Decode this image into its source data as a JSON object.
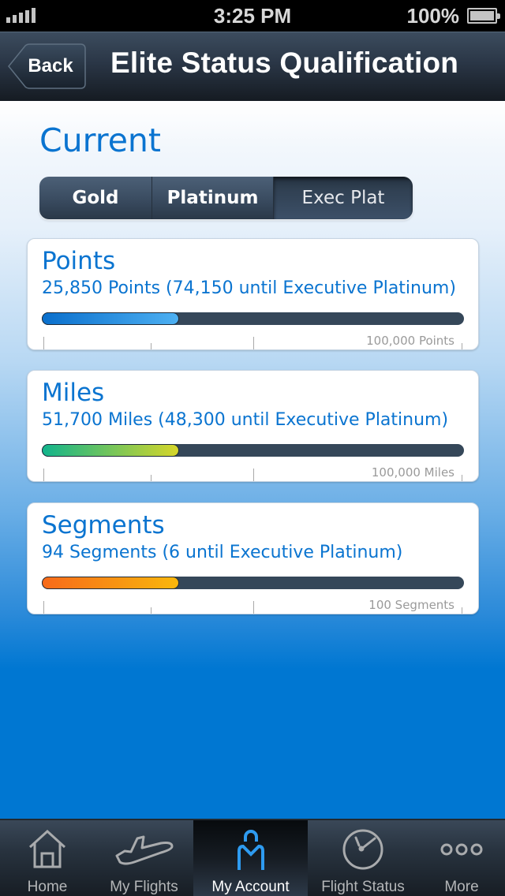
{
  "status_bar": {
    "time": "3:25 PM",
    "battery_percent": "100%",
    "signal_icon": "signal-bars-icon",
    "battery_icon": "battery-full-icon"
  },
  "nav": {
    "back_label": "Back",
    "title": "Elite Status Qualification"
  },
  "section_title": "Current",
  "segments": {
    "items": [
      {
        "label": "Gold",
        "selected": false
      },
      {
        "label": "Platinum",
        "selected": false
      },
      {
        "label": "Exec Plat",
        "selected": true
      }
    ]
  },
  "cards": [
    {
      "title": "Points",
      "detail": "25,850 Points (74,150 until Executive Platinum)",
      "max_label": "100,000 Points",
      "bar_fill_fraction": 0.325,
      "bar_colors": [
        "#0a6fcc",
        "#4db0f2"
      ]
    },
    {
      "title": "Miles",
      "detail": "51,700 Miles (48,300 until Executive Platinum)",
      "max_label": "100,000 Miles",
      "bar_fill_fraction": 0.325,
      "bar_colors": [
        "#12b48c",
        "#d6d62a"
      ]
    },
    {
      "title": "Segments",
      "detail": "94 Segments (6 until Executive Platinum)",
      "max_label": "100 Segments",
      "bar_fill_fraction": 0.325,
      "bar_colors": [
        "#f76a1a",
        "#f9b70c"
      ]
    }
  ],
  "tab_bar": {
    "items": [
      {
        "label": "Home",
        "icon": "home-icon",
        "active": false
      },
      {
        "label": "My Flights",
        "icon": "airplane-icon",
        "active": false
      },
      {
        "label": "My Account",
        "icon": "person-icon",
        "active": true
      },
      {
        "label": "Flight Status",
        "icon": "clock-icon",
        "active": false
      },
      {
        "label": "More",
        "icon": "more-dots-icon",
        "active": false
      }
    ]
  },
  "colors": {
    "accent_blue": "#0a74d0",
    "background_blue": "#0077d2",
    "active_tab_icon": "#2e9bf0"
  }
}
